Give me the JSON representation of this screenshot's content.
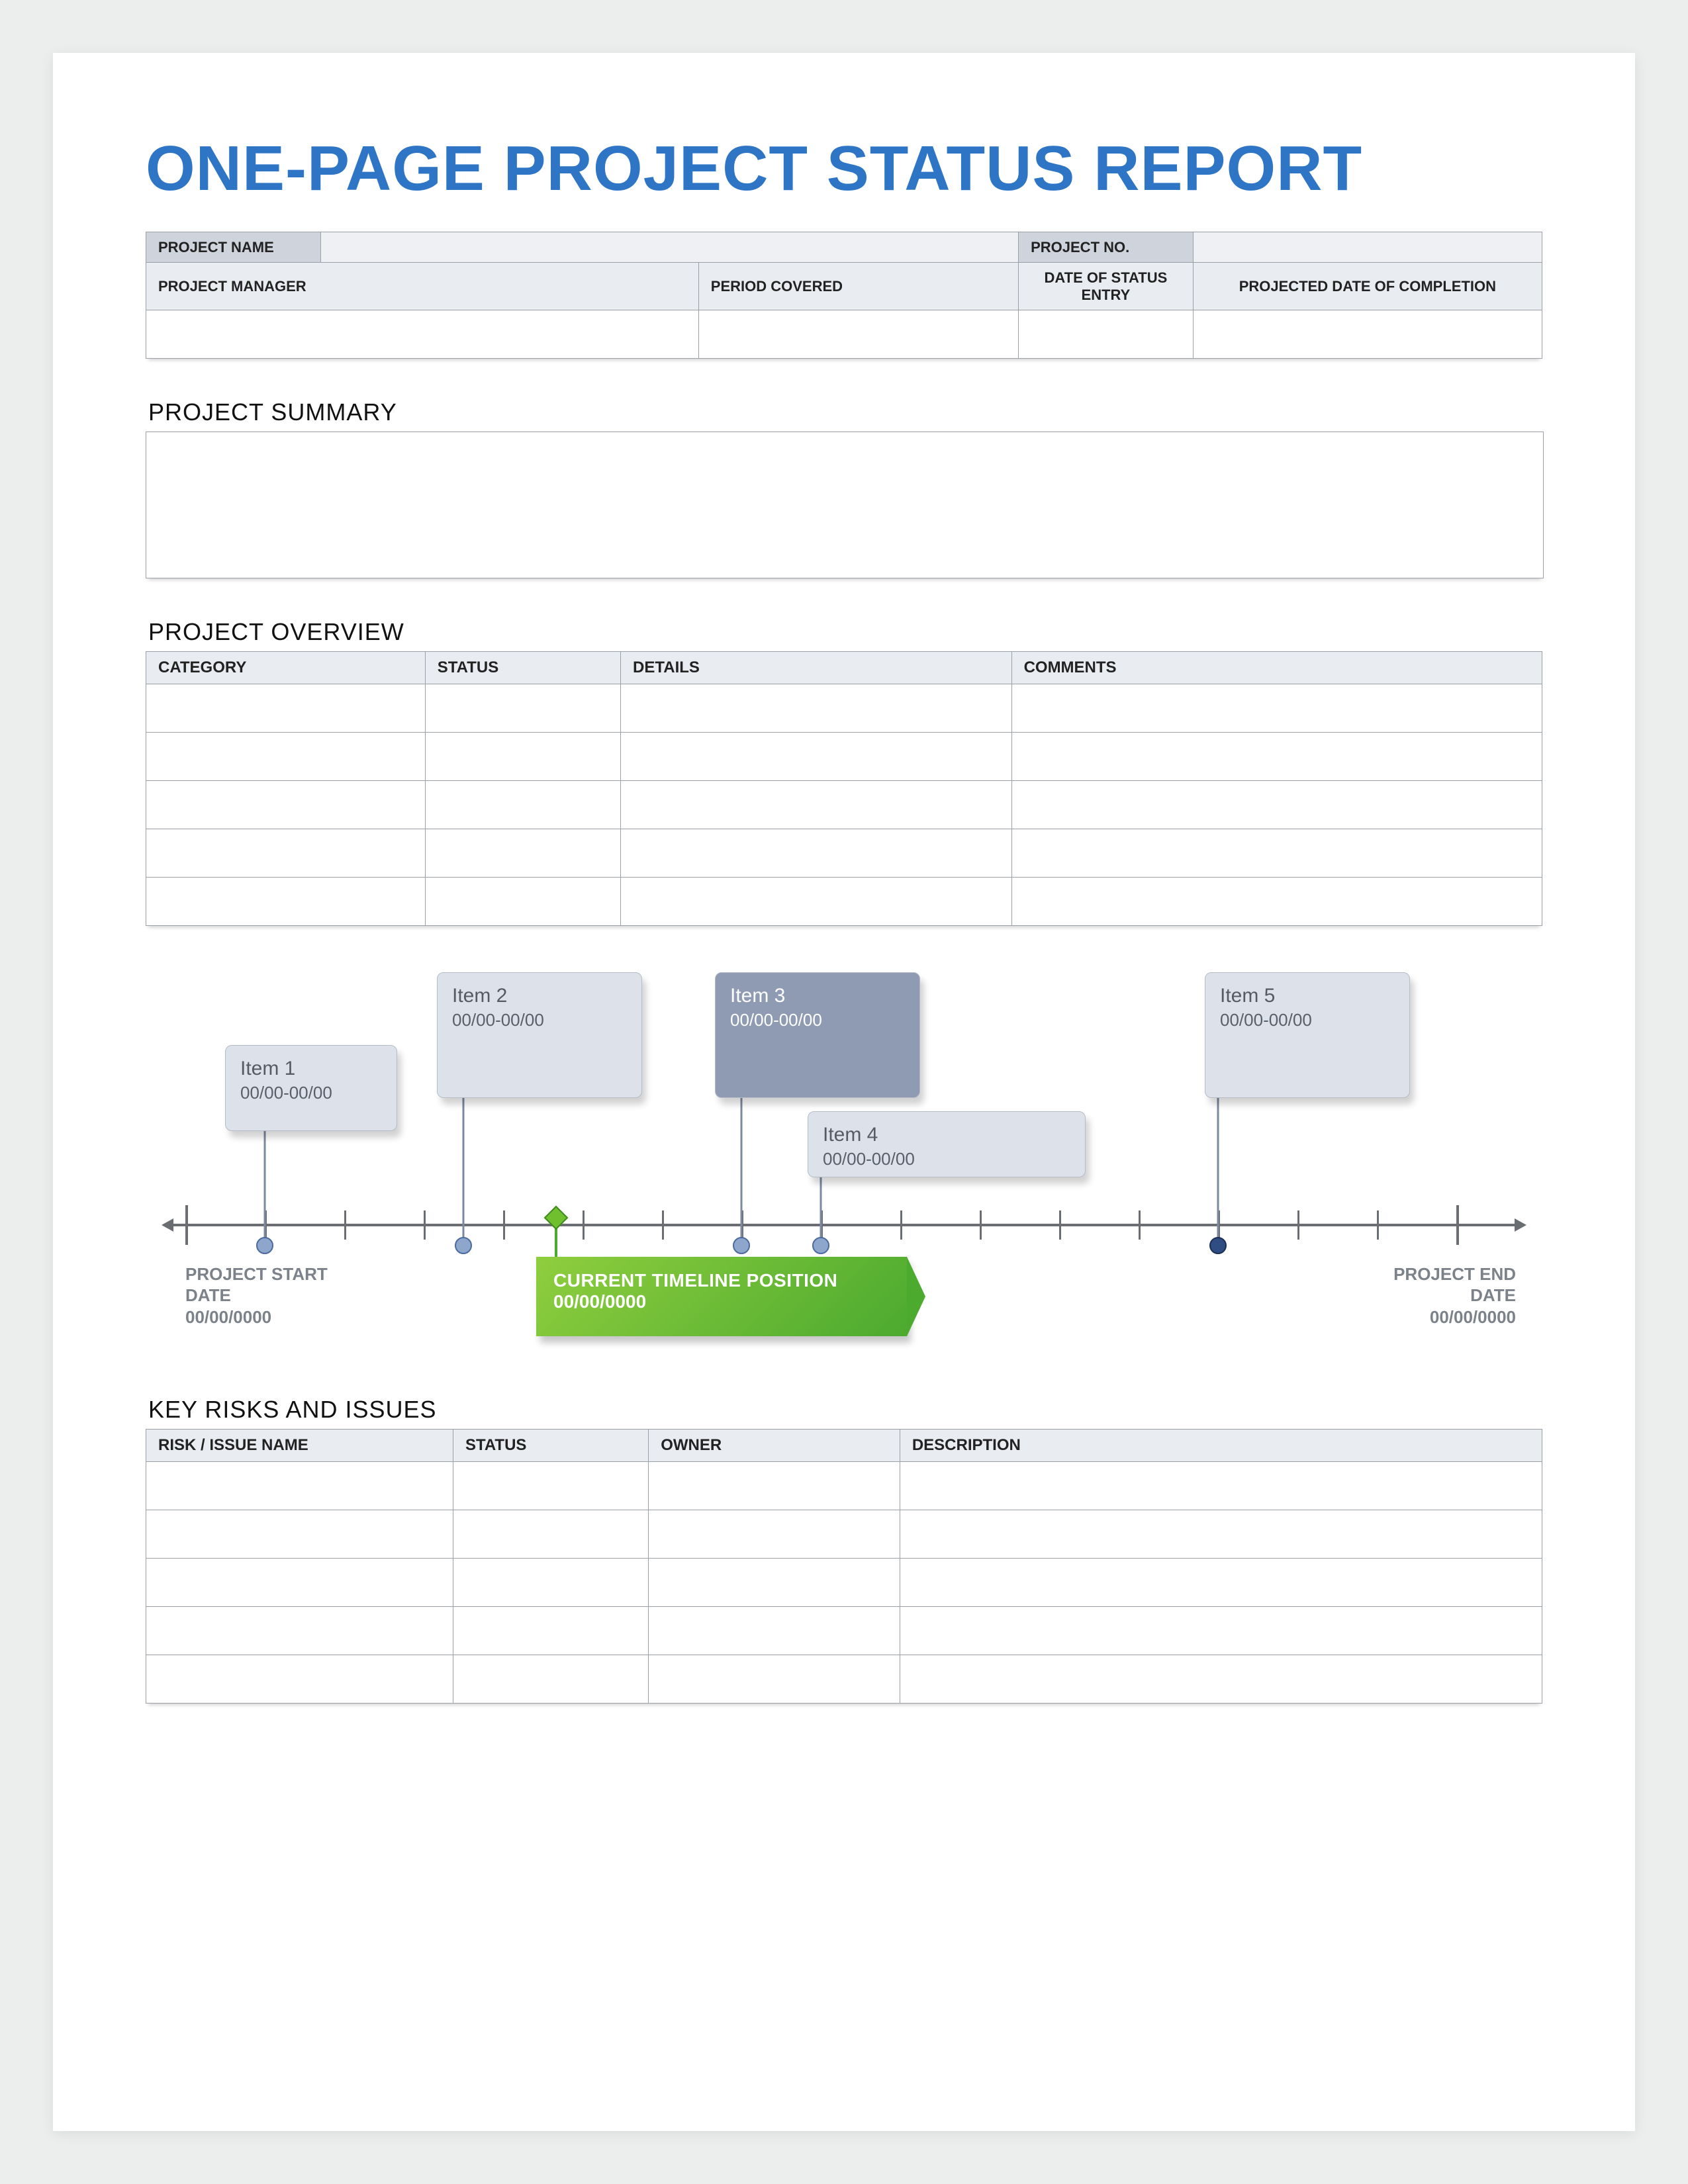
{
  "title": "ONE-PAGE PROJECT STATUS REPORT",
  "meta": {
    "project_name_label": "PROJECT NAME",
    "project_no_label": "PROJECT NO.",
    "project_manager_label": "PROJECT MANAGER",
    "period_covered_label": "PERIOD COVERED",
    "date_of_status_label": "DATE OF STATUS ENTRY",
    "projected_completion_label": "PROJECTED DATE OF COMPLETION",
    "project_name": "",
    "project_no": "",
    "project_manager": "",
    "period_covered": "",
    "date_of_status": "",
    "projected_completion": ""
  },
  "sections": {
    "summary_label": "PROJECT SUMMARY",
    "overview_label": "PROJECT OVERVIEW",
    "risks_label": "KEY RISKS AND ISSUES"
  },
  "overview": {
    "headers": {
      "category": "CATEGORY",
      "status": "STATUS",
      "details": "DETAILS",
      "comments": "COMMENTS"
    },
    "rows": [
      {
        "category": "",
        "status": "",
        "details": "",
        "comments": ""
      },
      {
        "category": "",
        "status": "",
        "details": "",
        "comments": ""
      },
      {
        "category": "",
        "status": "",
        "details": "",
        "comments": ""
      },
      {
        "category": "",
        "status": "",
        "details": "",
        "comments": ""
      },
      {
        "category": "",
        "status": "",
        "details": "",
        "comments": ""
      }
    ]
  },
  "risks": {
    "headers": {
      "name": "RISK / ISSUE NAME",
      "status": "STATUS",
      "owner": "OWNER",
      "description": "DESCRIPTION"
    },
    "rows": [
      {
        "name": "",
        "status": "",
        "owner": "",
        "description": ""
      },
      {
        "name": "",
        "status": "",
        "owner": "",
        "description": ""
      },
      {
        "name": "",
        "status": "",
        "owner": "",
        "description": ""
      },
      {
        "name": "",
        "status": "",
        "owner": "",
        "description": ""
      },
      {
        "name": "",
        "status": "",
        "owner": "",
        "description": ""
      }
    ]
  },
  "timeline": {
    "start_label": "PROJECT START DATE",
    "start_date": "00/00/0000",
    "end_label": "PROJECT END DATE",
    "end_date": "00/00/0000",
    "current_label": "CURRENT TIMELINE POSITION",
    "current_date": "00/00/0000",
    "items": [
      {
        "name": "Item 1",
        "range": "00/00-00/00"
      },
      {
        "name": "Item 2",
        "range": "00/00-00/00"
      },
      {
        "name": "Item 3",
        "range": "00/00-00/00"
      },
      {
        "name": "Item 4",
        "range": "00/00-00/00"
      },
      {
        "name": "Item 5",
        "range": "00/00-00/00"
      }
    ]
  }
}
